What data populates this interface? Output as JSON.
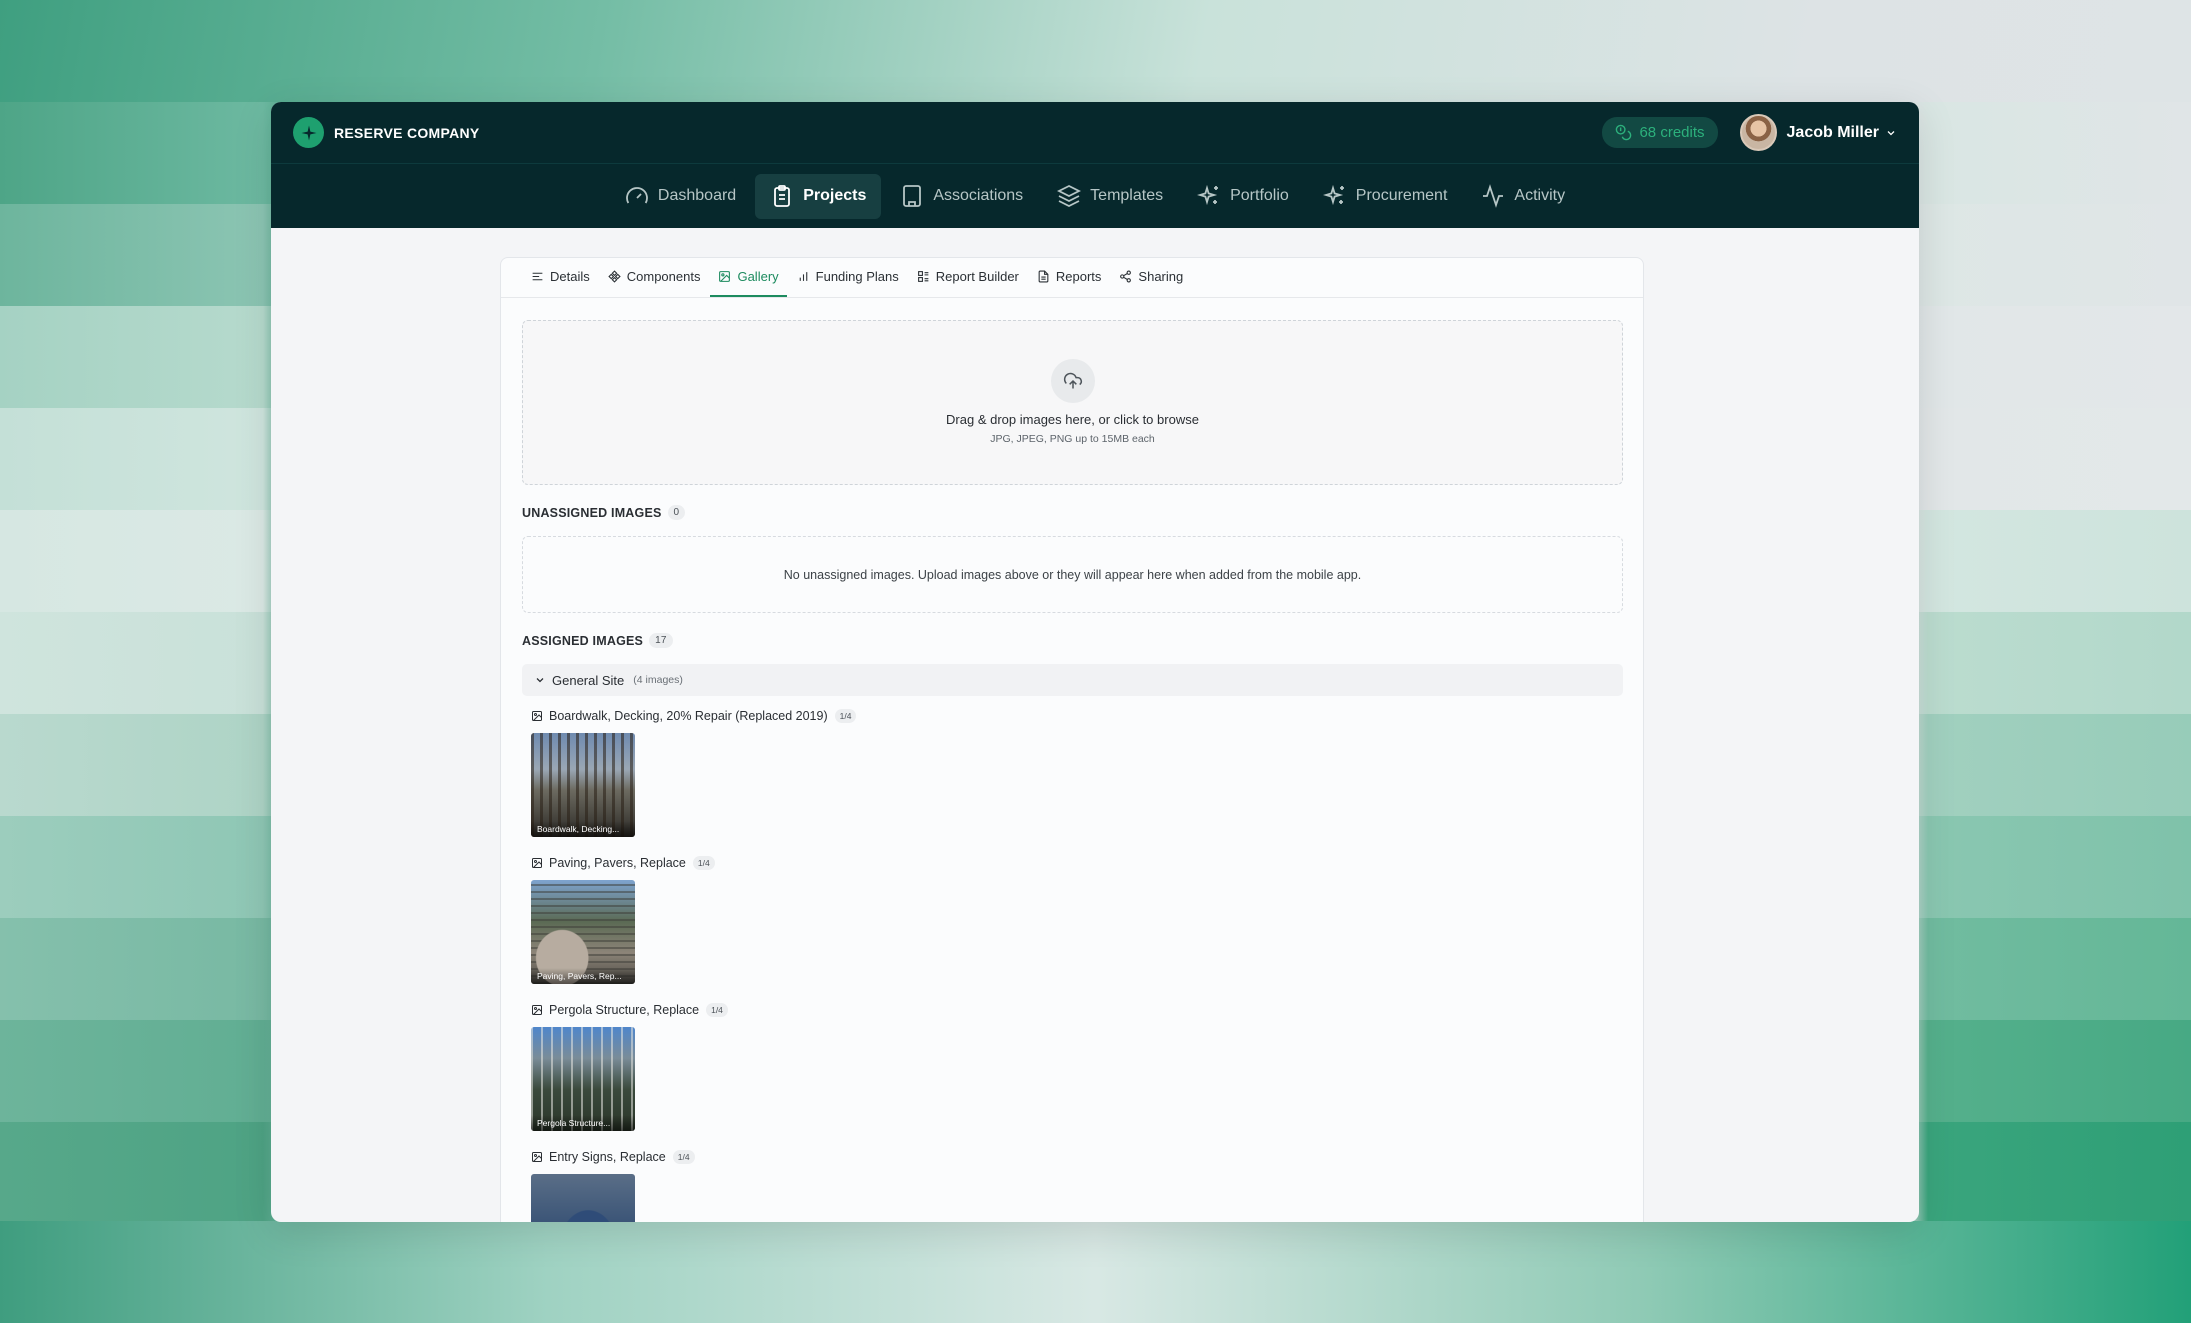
{
  "header": {
    "company_name": "RESERVE COMPANY",
    "credits_label": "68 credits",
    "user_name": "Jacob Miller"
  },
  "nav": {
    "items": [
      {
        "label": "Dashboard",
        "icon": "gauge-icon"
      },
      {
        "label": "Projects",
        "icon": "clipboard-icon",
        "active": true
      },
      {
        "label": "Associations",
        "icon": "building-icon"
      },
      {
        "label": "Templates",
        "icon": "layers-icon"
      },
      {
        "label": "Portfolio",
        "icon": "sparkles-icon"
      },
      {
        "label": "Procurement",
        "icon": "sparkles-icon"
      },
      {
        "label": "Activity",
        "icon": "activity-icon"
      }
    ]
  },
  "tabs": {
    "items": [
      {
        "label": "Details",
        "icon": "lines-icon"
      },
      {
        "label": "Components",
        "icon": "component-icon"
      },
      {
        "label": "Gallery",
        "icon": "image-icon",
        "active": true
      },
      {
        "label": "Funding Plans",
        "icon": "bar-chart-icon"
      },
      {
        "label": "Report Builder",
        "icon": "builder-icon"
      },
      {
        "label": "Reports",
        "icon": "file-icon"
      },
      {
        "label": "Sharing",
        "icon": "share-icon"
      }
    ]
  },
  "upload": {
    "title": "Drag & drop images here, or click to browse",
    "subtitle": "JPG, JPEG, PNG up to 15MB each"
  },
  "unassigned": {
    "title": "UNASSIGNED IMAGES",
    "count": "0",
    "empty_message": "No unassigned images. Upload images above or they will appear here when added from the mobile app."
  },
  "assigned": {
    "title": "ASSIGNED IMAGES",
    "count": "17",
    "groups": [
      {
        "name": "General Site",
        "count_label": "(4 images)",
        "components": [
          {
            "name": "Boardwalk, Decking, 20% Repair (Replaced 2019)",
            "badge": "1/4",
            "thumb_label": "Boardwalk, Decking..."
          },
          {
            "name": "Paving, Pavers, Replace",
            "badge": "1/4",
            "thumb_label": "Paving, Pavers, Rep..."
          },
          {
            "name": "Pergola Structure, Replace",
            "badge": "1/4",
            "thumb_label": "Pergola Structure..."
          },
          {
            "name": "Entry Signs, Replace",
            "badge": "1/4",
            "thumb_label": ""
          }
        ]
      }
    ]
  },
  "colors": {
    "topbar": "#06282c",
    "accent": "#1d8b5f",
    "credits_text": "#2cb07c"
  }
}
